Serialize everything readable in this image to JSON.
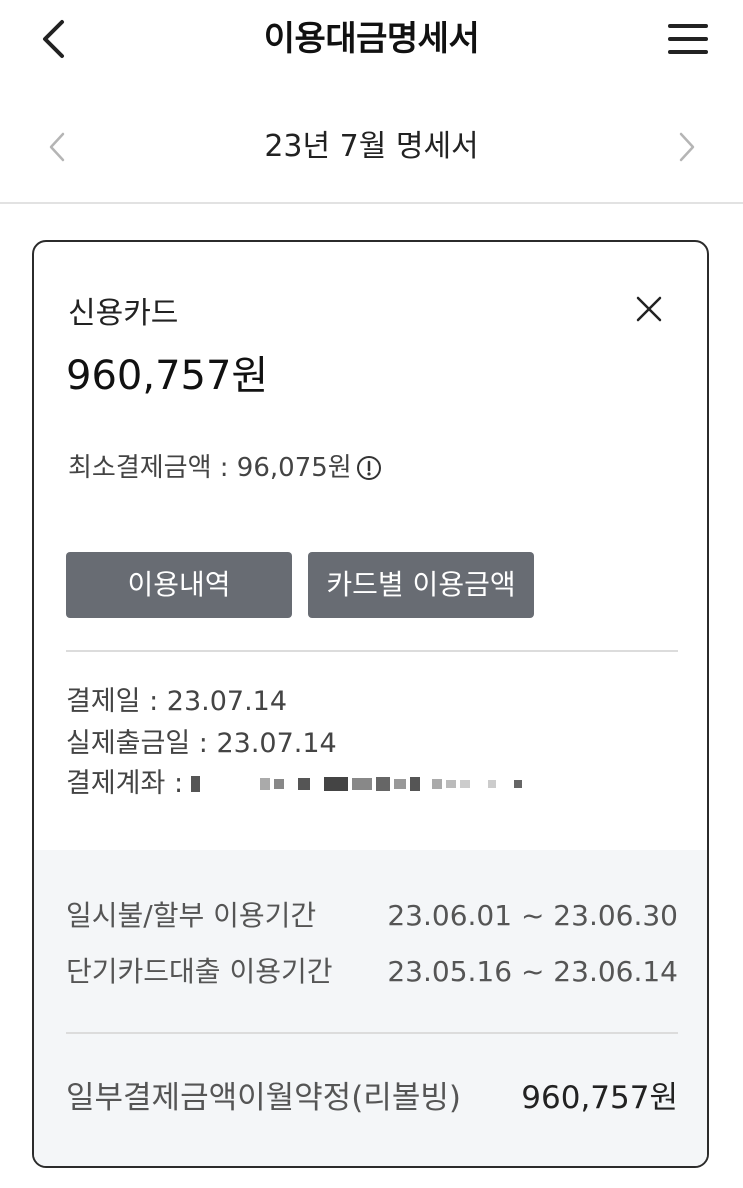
{
  "header": {
    "title": "이용대금명세서"
  },
  "month_nav": {
    "label": "23년 7월 명세서"
  },
  "card": {
    "title": "신용카드",
    "total_amount": "960,757원",
    "min_payment": "최소결제금액 : 96,075원",
    "buttons": {
      "usage": "이용내역",
      "by_card": "카드별 이용금액"
    },
    "payment_date": "결제일 : 23.07.14",
    "withdraw_date": "실제출금일 : 23.07.14",
    "account_label": "결제계좌 :",
    "periods": [
      {
        "label": "일시불/할부 이용기간",
        "value": "23.06.01 ~ 23.06.30"
      },
      {
        "label": "단기카드대출 이용기간",
        "value": "23.05.16 ~ 23.06.14"
      }
    ],
    "revolving": {
      "label": "일부결제금액이월약정(리볼빙)",
      "value": "960,757원"
    }
  }
}
